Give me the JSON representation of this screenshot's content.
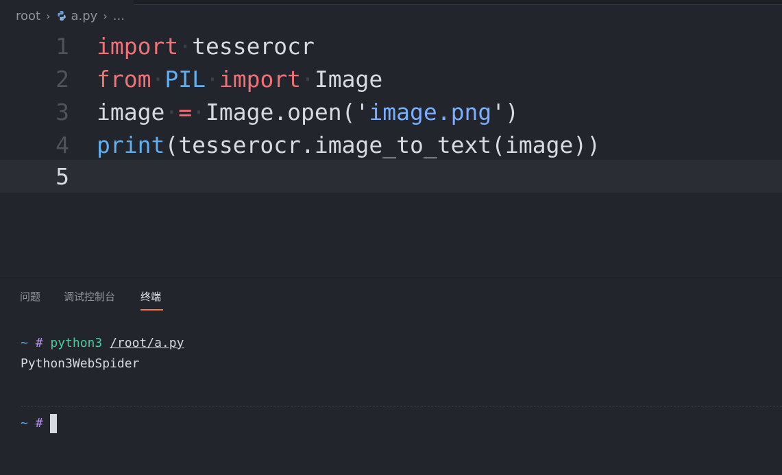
{
  "breadcrumb": {
    "root": "root",
    "file": "a.py",
    "more": "..."
  },
  "editor": {
    "lines": [
      {
        "number": "1",
        "tokens": [
          {
            "text": "import",
            "type": "kw"
          },
          {
            "text": "·",
            "type": "ws"
          },
          {
            "text": "tesserocr",
            "type": "plain"
          }
        ]
      },
      {
        "number": "2",
        "tokens": [
          {
            "text": "from",
            "type": "kw"
          },
          {
            "text": "·",
            "type": "ws"
          },
          {
            "text": "PIL",
            "type": "mod"
          },
          {
            "text": "·",
            "type": "ws"
          },
          {
            "text": "import",
            "type": "kw"
          },
          {
            "text": "·",
            "type": "ws"
          },
          {
            "text": "Image",
            "type": "plain"
          }
        ]
      },
      {
        "number": "3",
        "tokens": [
          {
            "text": "image",
            "type": "plain"
          },
          {
            "text": "·",
            "type": "ws"
          },
          {
            "text": "=",
            "type": "kw"
          },
          {
            "text": "·",
            "type": "ws"
          },
          {
            "text": "Image.open(",
            "type": "plain"
          },
          {
            "text": "'",
            "type": "plain"
          },
          {
            "text": "image.png",
            "type": "str"
          },
          {
            "text": "'",
            "type": "plain"
          },
          {
            "text": ")",
            "type": "plain"
          }
        ]
      },
      {
        "number": "4",
        "tokens": [
          {
            "text": "print",
            "type": "fn"
          },
          {
            "text": "(tesserocr.image_to_text(image))",
            "type": "plain"
          }
        ]
      },
      {
        "number": "5",
        "tokens": [],
        "current": true
      }
    ]
  },
  "panel": {
    "tabs": [
      "问题",
      "调试控制台",
      "终端"
    ],
    "active_tab": "终端"
  },
  "terminal": {
    "prompt_tilde": "~",
    "prompt_hash": "#",
    "command": "python3",
    "command_arg": "/root/a.py",
    "output": "Python3WebSpider"
  },
  "colors": {
    "accent": "#ff7a45",
    "keyword": "#f07178",
    "function": "#61afef",
    "terminal_command": "#4ec9a0"
  }
}
